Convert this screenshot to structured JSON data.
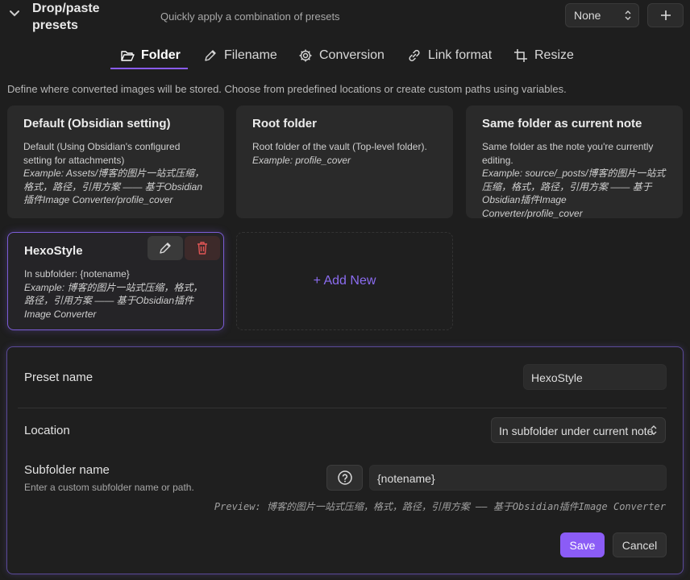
{
  "header": {
    "title": "Drop/paste presets",
    "description": "Quickly apply a combination of presets",
    "preset_select": "None",
    "add_label": "+"
  },
  "tabs": [
    {
      "label": "Folder",
      "icon": "folder-open-icon"
    },
    {
      "label": "Filename",
      "icon": "pencil-icon"
    },
    {
      "label": "Conversion",
      "icon": "gear-icon"
    },
    {
      "label": "Link format",
      "icon": "link-icon"
    },
    {
      "label": "Resize",
      "icon": "crop-icon"
    }
  ],
  "intro": "Define where converted images will be stored. Choose from predefined locations or create custom paths using variables.",
  "cards": [
    {
      "title": "Default (Obsidian setting)",
      "desc": "Default (Using Obsidian's configured setting for attachments)",
      "example": "Example: Assets/博客的图片一站式压缩，格式，路径，引用方案 —— 基于Obsidian插件Image Converter/profile_cover"
    },
    {
      "title": "Root folder",
      "desc": "Root folder of the vault (Top-level folder).",
      "example": "Example: profile_cover"
    },
    {
      "title": "Same folder as current note",
      "desc": "Same folder as the note you're currently editing.",
      "example": "Example: source/_posts/博客的图片一站式压缩，格式，路径，引用方案 —— 基于Obsidian插件Image Converter/profile_cover"
    },
    {
      "title": "HexoStyle",
      "desc": "In subfolder: {notename}",
      "example": "Example: 博客的图片一站式压缩，格式，路径，引用方案 —— 基于Obsidian插件Image Converter"
    }
  ],
  "add_new": "+ Add New",
  "editor": {
    "preset_name_label": "Preset name",
    "preset_name_value": "HexoStyle",
    "location_label": "Location",
    "location_value": "In subfolder under current note",
    "subfolder_label": "Subfolder name",
    "subfolder_hint": "Enter a custom subfolder name or path.",
    "subfolder_value": "{notename}",
    "preview": "Preview: 博客的图片一站式压缩，格式，路径，引用方案 —— 基于Obsidian插件Image Converter",
    "save": "Save",
    "cancel": "Cancel"
  },
  "colors": {
    "accent": "#8b5cf6",
    "background": "#1e1e1e",
    "delete": "#e05555"
  }
}
